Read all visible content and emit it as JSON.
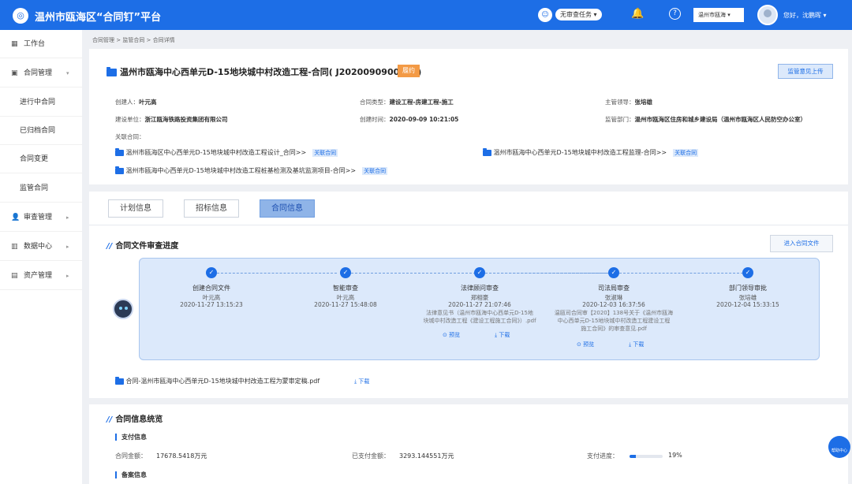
{
  "app": {
    "logo_glyph": "◎",
    "title": "温州市瓯海区“合同钉”平台",
    "task_select": "无审查任务 ▾",
    "region_select": "温州市瓯海 ▾",
    "greeting": "您好，沈鹏晖 ▾",
    "bell_glyph": "🔔",
    "help_glyph": "?",
    "robot_glyph": "☺"
  },
  "sidebar": {
    "items": [
      {
        "icon": "▦",
        "label": "工作台"
      },
      {
        "icon": "▣",
        "label": "合同管理",
        "arrow": "▾"
      },
      {
        "label": "进行中合同"
      },
      {
        "label": "已归档合同"
      },
      {
        "label": "合同变更"
      },
      {
        "label": "监管合同"
      },
      {
        "icon": "👤",
        "label": "审查管理",
        "arrow": "▸"
      },
      {
        "icon": "▥",
        "label": "数据中心",
        "arrow": "▸"
      },
      {
        "icon": "▤",
        "label": "资产管理",
        "arrow": "▸"
      }
    ]
  },
  "breadcrumb": "合同管理  >  监管合同  >  合同详情",
  "contract": {
    "title": "温州市瓯海中心西单元D-15地块城中村改造工程-合同( J2020090900001)",
    "status": "履约",
    "upload_button": "监管意见上传",
    "creator_label": "创建人：",
    "creator": "叶元高",
    "type_label": "合同类型：",
    "type": "建设工程-房建工程-施工",
    "leader_label": "主管领导：",
    "leader": "张培雄",
    "builder_label": "建设单位：",
    "builder": "浙江瓯海铁路投资集团有限公司",
    "created_label": "创建时间：",
    "created": "2020-09-09 10:21:05",
    "supervisor_label": "监管部门：",
    "supervisor": "温州市瓯海区住房和城乡建设局（温州市瓯海区人民防空办公室）",
    "related_label": "关联合同：",
    "related": [
      {
        "name": "温州市瓯海区中心西单元D-15地块城中村改造工程设计_合同>>",
        "tag": "关联合同"
      },
      {
        "name": "温州市瓯海中心西单元D-15地块城中村改造工程监理-合同>>",
        "tag": "关联合同"
      },
      {
        "name": "温州市瓯海中心西单元D-15地块城中村改造工程桩基检测及基坑监测项目-合同>>",
        "tag": "关联合同"
      }
    ]
  },
  "tabs": [
    "计划信息",
    "招标信息",
    "合同信息"
  ],
  "review": {
    "title": "合同文件审查进度",
    "enter_button": "进入合同文件",
    "steps": [
      {
        "name": "创建合同文件",
        "person": "叶元高",
        "time": "2020-11-27 13:15:23"
      },
      {
        "name": "智能审查",
        "person": "叶元高",
        "time": "2020-11-27 15:48:08"
      },
      {
        "name": "法律顾问审查",
        "person": "郑相豪",
        "time": "2020-11-27 21:07:46",
        "doc": [
          "法律意见书（温州市瓯海中心西单元D-15地",
          "块城中村改造工程《建设工程施工合同》）.pdf"
        ],
        "preview": "⊙ 预览",
        "download": "⤓ 下载"
      },
      {
        "name": "司法局审查",
        "person": "张淑琳",
        "time": "2020-12-03 16:37:56",
        "doc": [
          "温瓯司合同审【2020】138号关于《温州市瓯海",
          "中心西单元D-15地块城中村改造工程建设工程",
          "施工合同》的审查意见.pdf"
        ],
        "preview": "⊙ 预览",
        "download": "⤓ 下载"
      },
      {
        "name": "部门领导审批",
        "person": "张培雄",
        "time": "2020-12-04 15:33:15"
      }
    ],
    "file": "合同-温州市瓯海中心西单元D-15地块城中村改造工程为蒙审定稿.pdf",
    "file_download": "⤓ 下载"
  },
  "overview": {
    "title": "合同信息统览",
    "payment_title": "支付信息",
    "amount_label": "合同金额：",
    "amount": "17678.5418万元",
    "paid_label": "已支付金额：",
    "paid": "3293.144551万元",
    "progress_label": "支付进度：",
    "progress_pct": "19%",
    "progress_value": 0.19,
    "filing_title": "备案信息"
  },
  "float_help": "帮助中心",
  "colors": {
    "primary": "#1d6ee6",
    "status_tag": "#f39a45"
  }
}
